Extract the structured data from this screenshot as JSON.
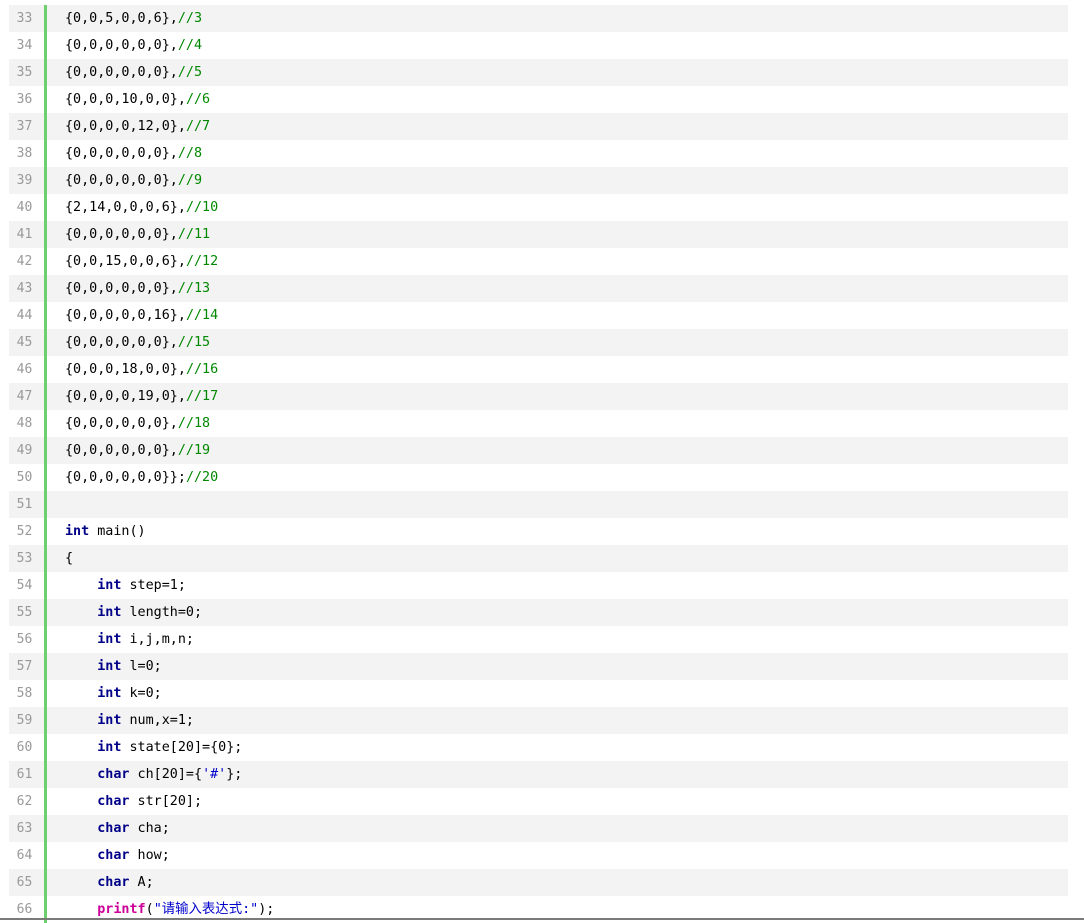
{
  "colors": {
    "keyword": "#000088",
    "comment": "#008800",
    "string": "#0000cc",
    "function": "#cc0099",
    "gutter_border": "#6ecf6e",
    "line_number": "#999999"
  },
  "lines": [
    {
      "n": "33",
      "tokens": [
        {
          "t": "plain",
          "v": "{0,0,5,0,0,6},"
        },
        {
          "t": "cm",
          "v": "//3"
        }
      ]
    },
    {
      "n": "34",
      "tokens": [
        {
          "t": "plain",
          "v": "{0,0,0,0,0,0},"
        },
        {
          "t": "cm",
          "v": "//4"
        }
      ]
    },
    {
      "n": "35",
      "tokens": [
        {
          "t": "plain",
          "v": "{0,0,0,0,0,0},"
        },
        {
          "t": "cm",
          "v": "//5"
        }
      ]
    },
    {
      "n": "36",
      "tokens": [
        {
          "t": "plain",
          "v": "{0,0,0,10,0,0},"
        },
        {
          "t": "cm",
          "v": "//6"
        }
      ]
    },
    {
      "n": "37",
      "tokens": [
        {
          "t": "plain",
          "v": "{0,0,0,0,12,0},"
        },
        {
          "t": "cm",
          "v": "//7"
        }
      ]
    },
    {
      "n": "38",
      "tokens": [
        {
          "t": "plain",
          "v": "{0,0,0,0,0,0},"
        },
        {
          "t": "cm",
          "v": "//8"
        }
      ]
    },
    {
      "n": "39",
      "tokens": [
        {
          "t": "plain",
          "v": "{0,0,0,0,0,0},"
        },
        {
          "t": "cm",
          "v": "//9"
        }
      ]
    },
    {
      "n": "40",
      "tokens": [
        {
          "t": "plain",
          "v": "{2,14,0,0,0,6},"
        },
        {
          "t": "cm",
          "v": "//10"
        }
      ]
    },
    {
      "n": "41",
      "tokens": [
        {
          "t": "plain",
          "v": "{0,0,0,0,0,0},"
        },
        {
          "t": "cm",
          "v": "//11"
        }
      ]
    },
    {
      "n": "42",
      "tokens": [
        {
          "t": "plain",
          "v": "{0,0,15,0,0,6},"
        },
        {
          "t": "cm",
          "v": "//12"
        }
      ]
    },
    {
      "n": "43",
      "tokens": [
        {
          "t": "plain",
          "v": "{0,0,0,0,0,0},"
        },
        {
          "t": "cm",
          "v": "//13"
        }
      ]
    },
    {
      "n": "44",
      "tokens": [
        {
          "t": "plain",
          "v": "{0,0,0,0,0,16},"
        },
        {
          "t": "cm",
          "v": "//14"
        }
      ]
    },
    {
      "n": "45",
      "tokens": [
        {
          "t": "plain",
          "v": "{0,0,0,0,0,0},"
        },
        {
          "t": "cm",
          "v": "//15"
        }
      ]
    },
    {
      "n": "46",
      "tokens": [
        {
          "t": "plain",
          "v": "{0,0,0,18,0,0},"
        },
        {
          "t": "cm",
          "v": "//16"
        }
      ]
    },
    {
      "n": "47",
      "tokens": [
        {
          "t": "plain",
          "v": "{0,0,0,0,19,0},"
        },
        {
          "t": "cm",
          "v": "//17"
        }
      ]
    },
    {
      "n": "48",
      "tokens": [
        {
          "t": "plain",
          "v": "{0,0,0,0,0,0},"
        },
        {
          "t": "cm",
          "v": "//18"
        }
      ]
    },
    {
      "n": "49",
      "tokens": [
        {
          "t": "plain",
          "v": "{0,0,0,0,0,0},"
        },
        {
          "t": "cm",
          "v": "//19"
        }
      ]
    },
    {
      "n": "50",
      "tokens": [
        {
          "t": "plain",
          "v": "{0,0,0,0,0,0}};"
        },
        {
          "t": "cm",
          "v": "//20"
        }
      ]
    },
    {
      "n": "51",
      "tokens": []
    },
    {
      "n": "52",
      "tokens": [
        {
          "t": "kw",
          "v": "int"
        },
        {
          "t": "plain",
          "v": " main()"
        }
      ]
    },
    {
      "n": "53",
      "tokens": [
        {
          "t": "plain",
          "v": "{"
        }
      ]
    },
    {
      "n": "54",
      "tokens": [
        {
          "t": "plain",
          "v": "    "
        },
        {
          "t": "kw",
          "v": "int"
        },
        {
          "t": "plain",
          "v": " step=1;"
        }
      ]
    },
    {
      "n": "55",
      "tokens": [
        {
          "t": "plain",
          "v": "    "
        },
        {
          "t": "kw",
          "v": "int"
        },
        {
          "t": "plain",
          "v": " length=0;"
        }
      ]
    },
    {
      "n": "56",
      "tokens": [
        {
          "t": "plain",
          "v": "    "
        },
        {
          "t": "kw",
          "v": "int"
        },
        {
          "t": "plain",
          "v": " i,j,m,n;"
        }
      ]
    },
    {
      "n": "57",
      "tokens": [
        {
          "t": "plain",
          "v": "    "
        },
        {
          "t": "kw",
          "v": "int"
        },
        {
          "t": "plain",
          "v": " l=0;"
        }
      ]
    },
    {
      "n": "58",
      "tokens": [
        {
          "t": "plain",
          "v": "    "
        },
        {
          "t": "kw",
          "v": "int"
        },
        {
          "t": "plain",
          "v": " k=0;"
        }
      ]
    },
    {
      "n": "59",
      "tokens": [
        {
          "t": "plain",
          "v": "    "
        },
        {
          "t": "kw",
          "v": "int"
        },
        {
          "t": "plain",
          "v": " num,x=1;"
        }
      ]
    },
    {
      "n": "60",
      "tokens": [
        {
          "t": "plain",
          "v": "    "
        },
        {
          "t": "kw",
          "v": "int"
        },
        {
          "t": "plain",
          "v": " state[20]={0};"
        }
      ]
    },
    {
      "n": "61",
      "tokens": [
        {
          "t": "plain",
          "v": "    "
        },
        {
          "t": "kw",
          "v": "char"
        },
        {
          "t": "plain",
          "v": " ch[20]={"
        },
        {
          "t": "str",
          "v": "'#'"
        },
        {
          "t": "plain",
          "v": "};"
        }
      ]
    },
    {
      "n": "62",
      "tokens": [
        {
          "t": "plain",
          "v": "    "
        },
        {
          "t": "kw",
          "v": "char"
        },
        {
          "t": "plain",
          "v": " str[20];"
        }
      ]
    },
    {
      "n": "63",
      "tokens": [
        {
          "t": "plain",
          "v": "    "
        },
        {
          "t": "kw",
          "v": "char"
        },
        {
          "t": "plain",
          "v": " cha;"
        }
      ]
    },
    {
      "n": "64",
      "tokens": [
        {
          "t": "plain",
          "v": "    "
        },
        {
          "t": "kw",
          "v": "char"
        },
        {
          "t": "plain",
          "v": " how;"
        }
      ]
    },
    {
      "n": "65",
      "tokens": [
        {
          "t": "plain",
          "v": "    "
        },
        {
          "t": "kw",
          "v": "char"
        },
        {
          "t": "plain",
          "v": " A;"
        }
      ]
    },
    {
      "n": "66",
      "tokens": [
        {
          "t": "plain",
          "v": "    "
        },
        {
          "t": "fn",
          "v": "printf"
        },
        {
          "t": "plain",
          "v": "("
        },
        {
          "t": "str",
          "v": "\"请输入表达式:\""
        },
        {
          "t": "plain",
          "v": ");"
        }
      ]
    }
  ]
}
